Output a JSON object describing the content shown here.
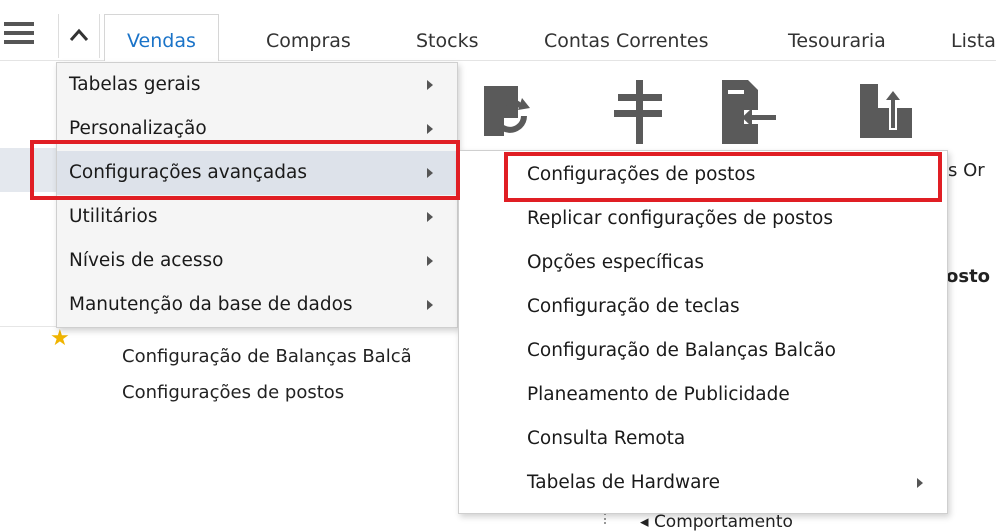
{
  "tabs": [
    {
      "label": "Vendas",
      "active": true
    },
    {
      "label": "Compras"
    },
    {
      "label": "Stocks"
    },
    {
      "label": "Contas Correntes"
    },
    {
      "label": "Tesouraria"
    },
    {
      "label": "Lista"
    }
  ],
  "background": {
    "right_label_1": "s Or",
    "right_label_2": "osto",
    "tree_items": [
      "Configuração de Balanças Balcã",
      "Configurações de postos"
    ],
    "bottom_partial": "Comportamento"
  },
  "menu": {
    "items": [
      {
        "label": "Tabelas gerais",
        "has_submenu": true
      },
      {
        "label": "Personalização",
        "has_submenu": true
      },
      {
        "label": "Configurações avançadas",
        "has_submenu": true,
        "highlighted": true
      },
      {
        "label": "Utilitários",
        "has_submenu": true
      },
      {
        "label": "Níveis de acesso",
        "has_submenu": true
      },
      {
        "label": "Manutenção da base de dados",
        "has_submenu": true
      }
    ]
  },
  "submenu": {
    "items": [
      {
        "label": "Configurações de postos",
        "outlined": true
      },
      {
        "label": "Replicar configurações de postos"
      },
      {
        "label": "Opções específicas"
      },
      {
        "label": "Configuração de teclas"
      },
      {
        "label": "Configuração de Balanças Balcão"
      },
      {
        "label": "Planeamento de Publicidade"
      },
      {
        "label": "Consulta Remota"
      },
      {
        "label": "Tabelas de Hardware",
        "has_submenu": true
      }
    ]
  },
  "colors": {
    "accent": "#1a73c8",
    "highlight_box": "#e01e24",
    "icon": "#5a5a5a",
    "star": "#f0b400"
  }
}
